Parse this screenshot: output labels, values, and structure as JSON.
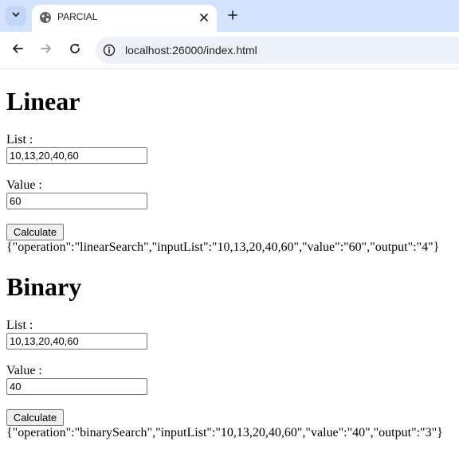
{
  "browser": {
    "tab_title": "PARCIAL",
    "url": "localhost:26000/index.html",
    "icons": {
      "tab_list": "chevron-down-icon",
      "favicon": "globe-icon",
      "close": "close-icon",
      "new_tab": "plus-icon",
      "back": "back-arrow-icon",
      "forward": "forward-arrow-icon",
      "reload": "reload-icon",
      "site_info": "site-info-icon"
    }
  },
  "linear": {
    "heading": "Linear",
    "list_label": "List :",
    "list_value": "10,13,20,40,60",
    "value_label": "Value :",
    "value_value": "60",
    "button_label": "Calculate",
    "result": "{\"operation\":\"linearSearch\",\"inputList\":\"10,13,20,40,60\",\"value\":\"60\",\"output\":\"4\"}"
  },
  "binary": {
    "heading": "Binary",
    "list_label": "List :",
    "list_value": "10,13,20,40,60",
    "value_label": "Value :",
    "value_value": "40",
    "button_label": "Calculate",
    "result": "{\"operation\":\"binarySearch\",\"inputList\":\"10,13,20,40,60\",\"value\":\"40\",\"output\":\"3\"}"
  }
}
